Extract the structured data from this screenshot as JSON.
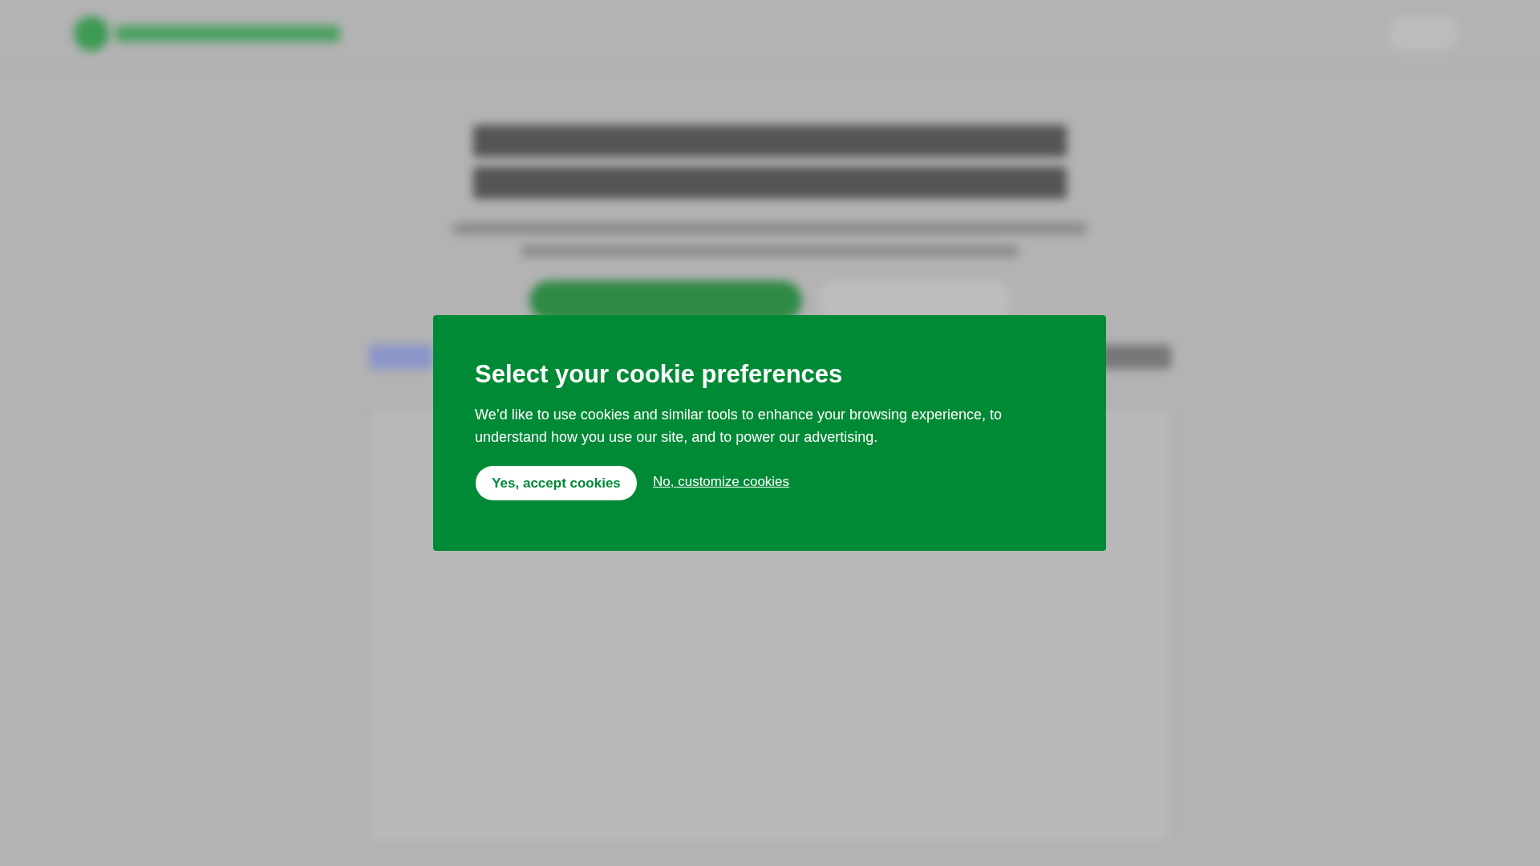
{
  "cookie_dialog": {
    "title": "Select your cookie preferences",
    "body": "We’d like to use cookies and similar tools to enhance your browsing experience, to understand how you use our site, and to power our advertising.",
    "accept_button": "Yes, accept cookies",
    "customize_link": "No, customize cookies"
  }
}
